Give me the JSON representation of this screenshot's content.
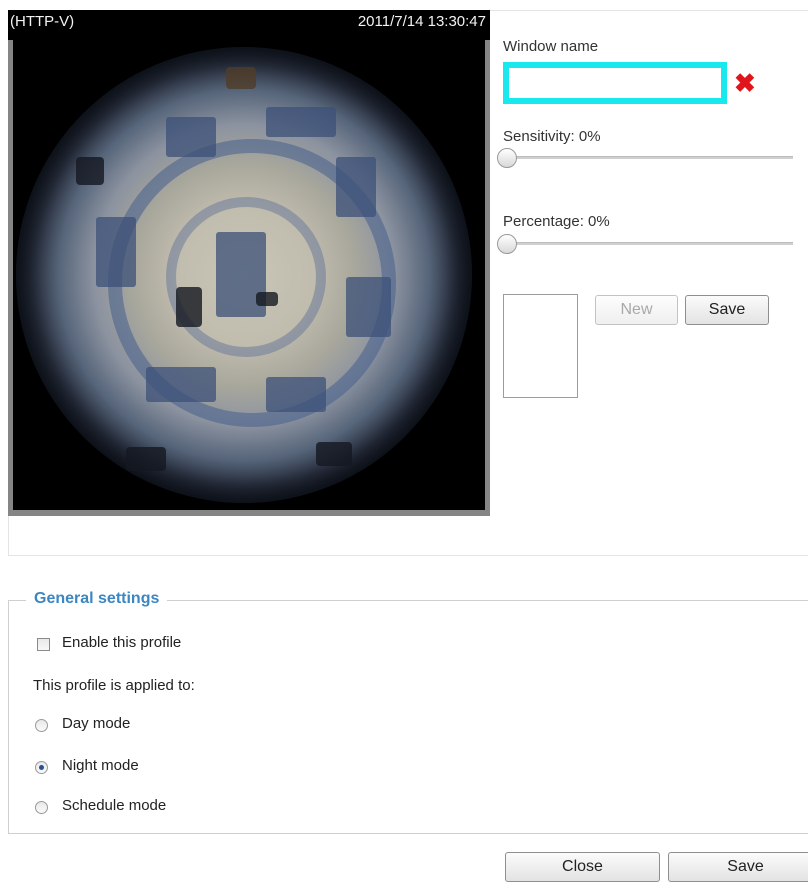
{
  "video": {
    "stream_label": "(HTTP-V)",
    "timestamp": "2011/7/14 13:30:47"
  },
  "window": {
    "name_label": "Window name",
    "name_value": "",
    "delete_icon": "red-x-icon"
  },
  "sensitivity": {
    "label": "Sensitivity: 0%",
    "value": 0
  },
  "percentage": {
    "label": "Percentage: 0%",
    "value": 0
  },
  "window_buttons": {
    "new_label": "New",
    "save_label": "Save"
  },
  "general": {
    "legend": "General settings",
    "enable_label": "Enable this profile",
    "enable_checked": false,
    "applied_label": "This profile is applied to:",
    "modes": [
      {
        "label": "Day mode",
        "checked": false
      },
      {
        "label": "Night mode",
        "checked": true
      },
      {
        "label": "Schedule mode",
        "checked": false
      }
    ]
  },
  "footer": {
    "close_label": "Close",
    "save_label": "Save"
  },
  "colors": {
    "input_highlight": "#19e8ef",
    "delete_icon": "#e0141b",
    "legend": "#3c86c2"
  }
}
